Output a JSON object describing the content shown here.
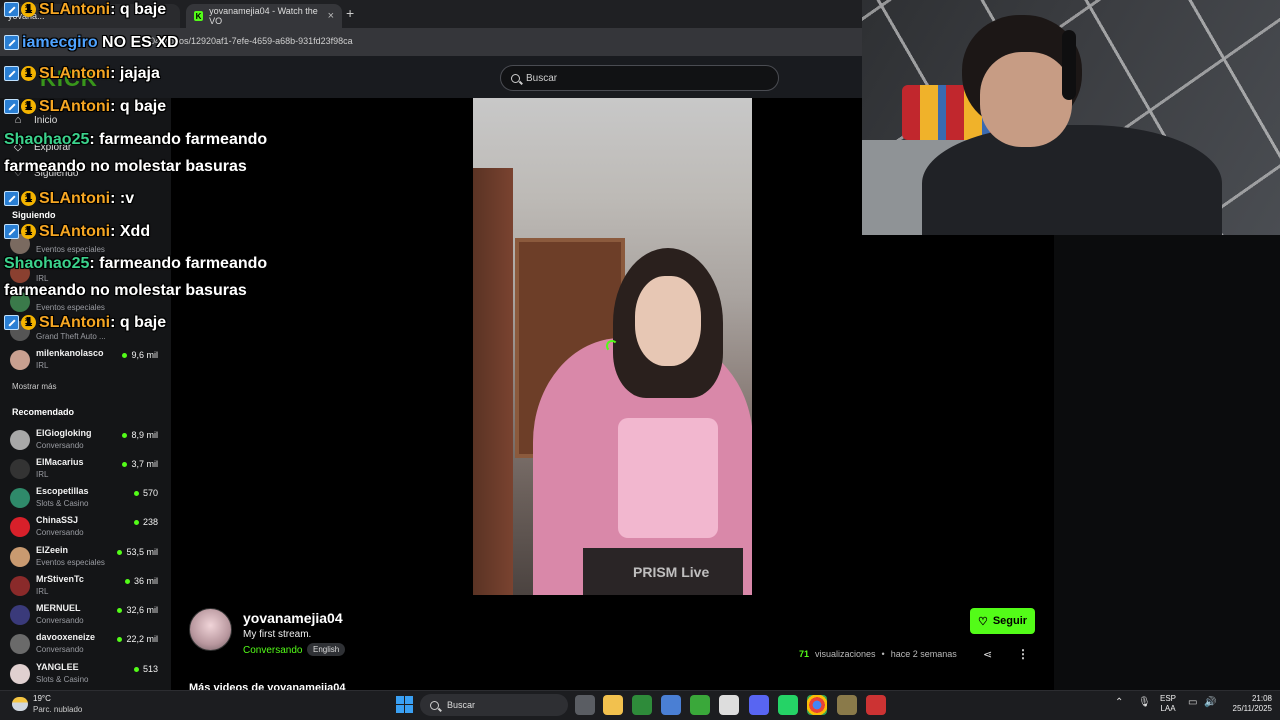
{
  "browser": {
    "tab1_title": "yovana...",
    "tab2_title": "yovanamejia04 - Watch the VO",
    "tab_close": "×",
    "newtab": "+",
    "url": "04/videos/12920af1-7efe-4659-a68b-931fd23f98ca"
  },
  "site": {
    "logo": "KICK",
    "search_placeholder": "Buscar"
  },
  "sidebar": {
    "nav": [
      {
        "label": "Inicio",
        "icon": "home-icon"
      },
      {
        "label": "Explorar",
        "icon": "compass-icon"
      },
      {
        "label": "Siguiendo",
        "icon": "heart-icon"
      }
    ],
    "following_title": "Siguiendo",
    "following": [
      {
        "name": "",
        "category": "Eventos especiales",
        "viewers": ""
      },
      {
        "name": "",
        "category": "IRL",
        "viewers": ""
      },
      {
        "name": "",
        "category": "Eventos especiales",
        "viewers": ""
      },
      {
        "name": "",
        "category": "Grand Theft Auto ...",
        "viewers": ""
      },
      {
        "name": "milenkanolasco",
        "category": "IRL",
        "viewers": "9,6 mil"
      }
    ],
    "show_more": "Mostrar más",
    "recommended_title": "Recomendado",
    "recommended": [
      {
        "name": "ElGiogloking",
        "category": "Conversando",
        "viewers": "8,9 mil"
      },
      {
        "name": "ElMacarius",
        "category": "IRL",
        "viewers": "3,7 mil"
      },
      {
        "name": "Escopetillas",
        "category": "Slots & Casino",
        "viewers": "570"
      },
      {
        "name": "ChinaSSJ",
        "category": "Conversando",
        "viewers": "238"
      },
      {
        "name": "ElZeein",
        "category": "Eventos especiales",
        "viewers": "53,5 mil"
      },
      {
        "name": "MrStivenTc",
        "category": "IRL",
        "viewers": "36 mil"
      },
      {
        "name": "MERNUEL",
        "category": "Conversando",
        "viewers": "32,6 mil"
      },
      {
        "name": "davooxeneize",
        "category": "Conversando",
        "viewers": "22,2 mil"
      },
      {
        "name": "YANGLEE",
        "category": "Slots & Casino",
        "viewers": "513"
      }
    ]
  },
  "video": {
    "watermark": "PRISM Live"
  },
  "info": {
    "streamer": "yovanamejia04",
    "title": "My first stream.",
    "category": "Conversando",
    "language": "English",
    "follow_label": "Seguir",
    "views_num": "71",
    "views_label": "visualizaciones",
    "separator": "•",
    "age": "hace 2 semanas",
    "more_videos": "Más videos de yovanamejia04"
  },
  "chat": [
    {
      "user": "SLAntoni",
      "text": ": q baje",
      "color": "orange",
      "badges": true
    },
    {
      "user": "iamecgiro",
      "text": " NO ES XD",
      "color": "blue",
      "badges": false
    },
    {
      "user": "SLAntoni",
      "text": ": jajaja",
      "color": "orange",
      "badges": true
    },
    {
      "user": "SLAntoni",
      "text": ": q baje",
      "color": "orange",
      "badges": true
    },
    {
      "user": "Shaohao25",
      "text": ": farmeando farmeando",
      "color": "green",
      "badges": false,
      "cont": "farmeando no molestar basuras"
    },
    {
      "user": "SLAntoni",
      "text": ": :v",
      "color": "orange",
      "badges": true
    },
    {
      "user": "SLAntoni",
      "text": ": Xdd",
      "color": "orange",
      "badges": true
    },
    {
      "user": "Shaohao25",
      "text": ": farmeando farmeando",
      "color": "green",
      "badges": false,
      "cont": "farmeando no molestar basuras"
    },
    {
      "user": "SLAntoni",
      "text": ": q baje",
      "color": "orange",
      "badges": true
    }
  ],
  "taskbar": {
    "temp": "19°C",
    "weather": "Parc. nublado",
    "search": "Buscar",
    "lang1": "ESP",
    "lang2": "LAA",
    "time": "21:08",
    "date": "25/11/2025"
  }
}
